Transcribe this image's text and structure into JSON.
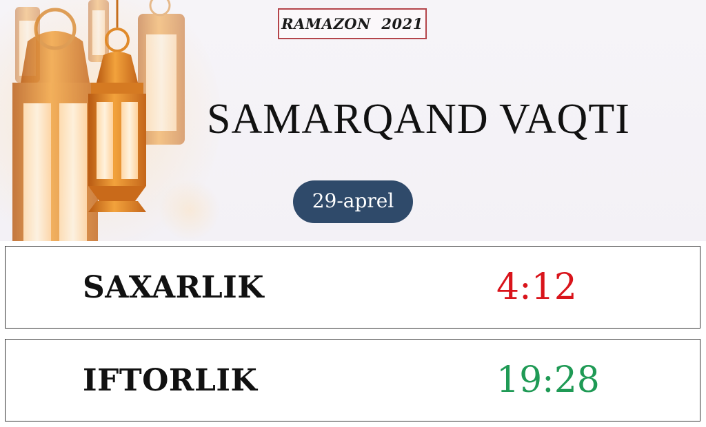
{
  "header": {
    "badge": "RAMAZON  2021",
    "title": "SAMARQAND VAQTI",
    "date": "29-aprel"
  },
  "rows": [
    {
      "label": "SAXARLIK",
      "time": "4:12",
      "time_color": "#d9141b"
    },
    {
      "label": "IFTORLIK",
      "time": "19:28",
      "time_color": "#1f9a55"
    }
  ],
  "colors": {
    "badge_border": "#b4444a",
    "date_pill": "#2f4a6a",
    "lantern_gold": "#e8932a"
  },
  "decoration": {
    "icon": "ramadan-lanterns-icon"
  }
}
